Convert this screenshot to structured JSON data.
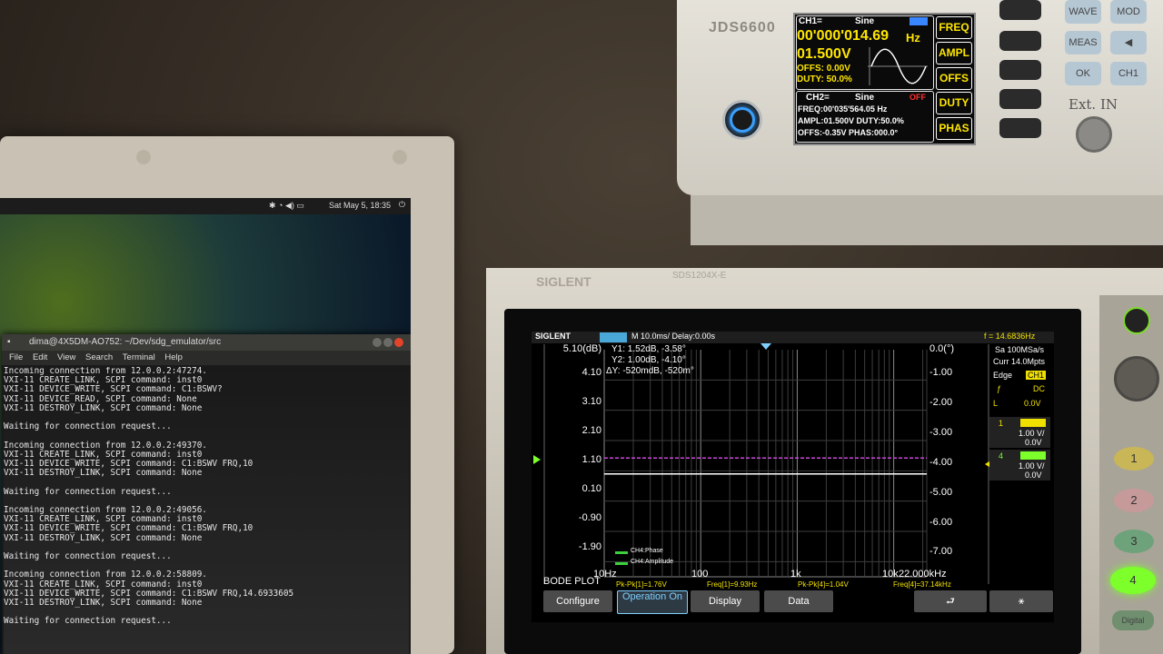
{
  "laptop": {
    "panel_clock": "Sat May 5, 18:35",
    "terminal": {
      "title": "dima@4X5DM-AO752: ~/Dev/sdg_emulator/src",
      "menu": [
        "File",
        "Edit",
        "View",
        "Search",
        "Terminal",
        "Help"
      ],
      "lines": [
        "Incoming connection from 12.0.0.2:47274.",
        "VXI-11 CREATE_LINK, SCPI command: inst0",
        "VXI-11 DEVICE_WRITE, SCPI command: C1:BSWV?",
        "VXI-11 DEVICE_READ, SCPI command: None",
        "VXI-11 DESTROY_LINK, SCPI command: None",
        "",
        "Waiting for connection request...",
        "",
        "Incoming connection from 12.0.0.2:49370.",
        "VXI-11 CREATE_LINK, SCPI command: inst0",
        "VXI-11 DEVICE_WRITE, SCPI command: C1:BSWV FRQ,10",
        "VXI-11 DESTROY_LINK, SCPI command: None",
        "",
        "Waiting for connection request...",
        "",
        "Incoming connection from 12.0.0.2:49056.",
        "VXI-11 CREATE_LINK, SCPI command: inst0",
        "VXI-11 DEVICE_WRITE, SCPI command: C1:BSWV FRQ,10",
        "VXI-11 DESTROY_LINK, SCPI command: None",
        "",
        "Waiting for connection request...",
        "",
        "Incoming connection from 12.0.0.2:58809.",
        "VXI-11 CREATE_LINK, SCPI command: inst0",
        "VXI-11 DEVICE_WRITE, SCPI command: C1:BSWV FRQ,14.6933605",
        "VXI-11 DESTROY_LINK, SCPI command: None",
        "",
        "Waiting for connection request..."
      ]
    }
  },
  "generator": {
    "brand": "JDS6600",
    "ch1": {
      "header": "CH1=",
      "wave": "Sine",
      "freq": "00'000'014.69",
      "freq_unit": "Hz",
      "ampl": "01.500V",
      "offs": "OFFS: 0.00V",
      "duty": "DUTY: 50.0%"
    },
    "ch2": {
      "header": "CH2=",
      "wave": "Sine",
      "state": "OFF",
      "freq": "FREQ:00'035'564.05 Hz",
      "ampl": "AMPL:01.500V DUTY:50.0%",
      "offs": "OFFS:-0.35V PHAS:000.0°"
    },
    "softkeys": [
      "FREQ",
      "AMPL",
      "OFFS",
      "DUTY",
      "PHAS"
    ],
    "right_keys": [
      "WAVE",
      "MOD",
      "MEAS",
      "OK",
      "CH1"
    ],
    "ext_in": "Ext. IN"
  },
  "scope": {
    "brand": "SIGLENT",
    "model": "SDS1204X-E",
    "header": {
      "brand": "SIGLENT",
      "status": "M 10.0ms/ Delay:0.00s",
      "freq": "f = 14.6836Hz"
    },
    "cursors": {
      "y1": "Y1: 1.52dB, -3.58°",
      "y2": "Y2: 1.00dB, -4.10°",
      "dy": "ΔY: -520mdB, -520m°"
    },
    "left_axis": [
      "5.10(dB)",
      "4.10",
      "3.10",
      "2.10",
      "1.10",
      "0.10",
      "-0.90",
      "-1.90"
    ],
    "right_axis": [
      "0.0(°)",
      "-1.00",
      "-2.00",
      "-3.00",
      "-4.00",
      "-5.00",
      "-6.00",
      "-7.00"
    ],
    "x_axis": [
      "10Hz",
      "100",
      "1k",
      "10k",
      "22.000kHz"
    ],
    "legend": [
      "CH4:Phase",
      "CH4:Amplitude"
    ],
    "side": {
      "sa": "Sa 100MSa/s",
      "curr": "Curr 14.0Mpts",
      "trigger": "Edge",
      "trig_ch": "CH1",
      "coupling": "DC",
      "level_label": "L",
      "level": "0.0V",
      "ch1": "1",
      "ch1_vdiv": "1.00 V/",
      "ch1_off": "0.0V",
      "ch4": "4",
      "ch4_vdiv": "1.00 V/",
      "ch4_off": "0.0V"
    },
    "mode_label": "BODE PLOT",
    "measurements": [
      "Pk-Pk[1]=1.76V",
      "Freq[1]=9.93Hz",
      "Pk-Pk[4]=1.04V",
      "Freq[4]=37.14kHz"
    ],
    "menu": [
      "Configure",
      "Operation On",
      "Display",
      "Data"
    ],
    "channel_buttons": [
      "1",
      "2",
      "3",
      "4"
    ],
    "digital": "Digital",
    "chart_data": {
      "type": "line",
      "x_scale": "log",
      "xlim": [
        10,
        22000
      ],
      "left_ylim": [
        -2.4,
        5.1
      ],
      "right_ylim": [
        -7.5,
        0.0
      ],
      "series": [
        {
          "name": "CH4:Phase",
          "color": "#c84ad8",
          "x": [
            10,
            22000
          ],
          "y": [
            -3.58,
            -3.58
          ],
          "axis": "right"
        },
        {
          "name": "CH4:Amplitude",
          "color": "#ffffff",
          "x": [
            10,
            22000
          ],
          "y": [
            1.0,
            1.0
          ],
          "axis": "left"
        }
      ]
    }
  }
}
